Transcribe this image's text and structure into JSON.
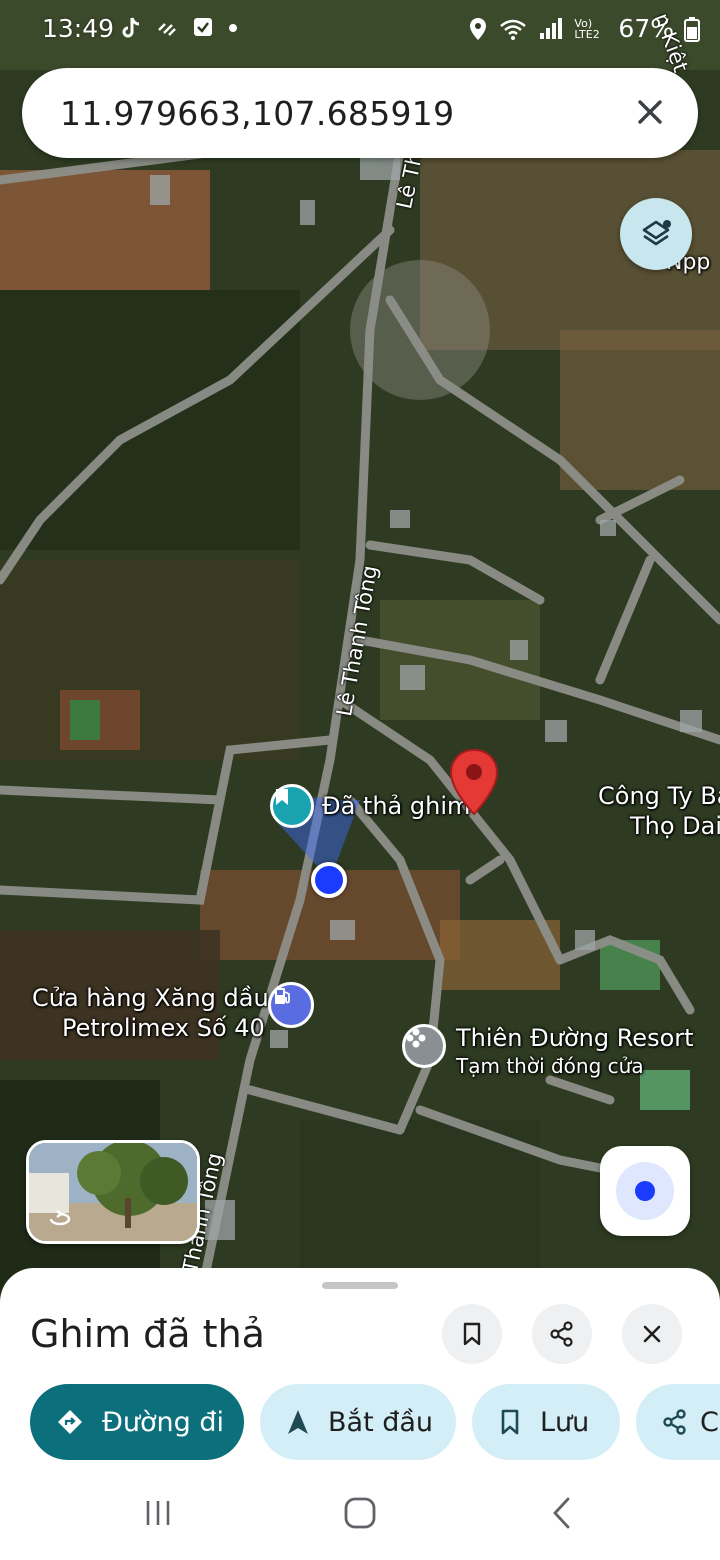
{
  "status_bar": {
    "time": "13:49",
    "battery": "67%",
    "network": "Vo) LTE2"
  },
  "search": {
    "query": "11.979663,107.685919"
  },
  "map": {
    "labels": {
      "road_top": "Lê Th",
      "road_mid": "Lê Thanh Tông",
      "road_bottom": "Thánh Tông",
      "top_right_road": "n Kiệt",
      "npp": "Npp",
      "dropped_pin": "Đã thả ghim",
      "company": "Công Ty Ba",
      "company_line2": "Thọ Dai-",
      "gas_station_line1": "Cửa hàng Xăng dầu",
      "gas_station_line2": "Petrolimex Số 40",
      "resort": "Thiên Đường Resort",
      "resort_status": "Tạm thời đóng cửa"
    }
  },
  "sheet": {
    "title": "Ghim đã thả",
    "chips": {
      "directions": "Đường đi",
      "start": "Bắt đầu",
      "save": "Lưu",
      "share": "C"
    }
  },
  "colors": {
    "primary": "#0b6f7c",
    "chip_bg": "#d3eef6",
    "pin_red": "#e53935",
    "location_blue": "#1a3cff"
  }
}
